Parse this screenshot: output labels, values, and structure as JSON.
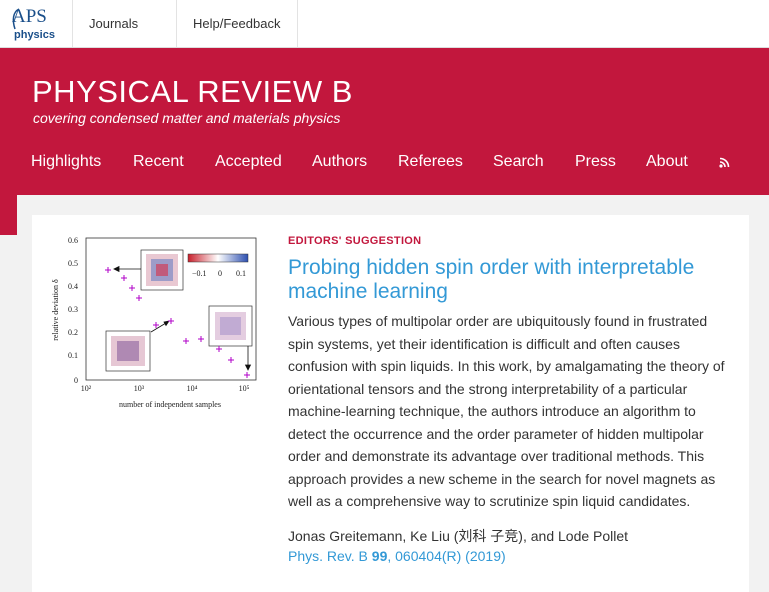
{
  "topbar": {
    "logo_aps": "APS",
    "logo_physics": "physics",
    "journals_label": "Journals",
    "help_label": "Help/Feedback"
  },
  "banner": {
    "journal_title": "PHYSICAL REVIEW B",
    "journal_subtitle": "covering condensed matter and materials physics",
    "menu": [
      "Highlights",
      "Recent",
      "Accepted",
      "Authors",
      "Referees",
      "Search",
      "Press",
      "About"
    ],
    "rss_icon": "rss-icon"
  },
  "article": {
    "label": "EDITORS' SUGGESTION",
    "title": "Probing hidden spin order with interpretable machine learning",
    "abstract": "Various types of multipolar order are ubiquitously found in frustrated spin systems, yet their identification is difficult and often causes confusion with spin liquids. In this work, by amalgamating the theory of orientational tensors and the strong interpretability of a particular machine-learning technique, the authors introduce an algorithm to detect the occurrence and the order parameter of hidden multipolar order and demonstrate its advantage over traditional methods. This approach provides a new scheme in the search for novel magnets as well as a comprehensive way to scrutinize spin liquid candidates.",
    "authors": "Jonas Greitemann, Ke Liu (刘科 子竞), and Lode Pollet",
    "citation_prefix": "Phys. Rev. B ",
    "citation_volume": "99",
    "citation_suffix": ", 060404(R) (2019)"
  },
  "figure": {
    "ylabel": "relative deviation δ",
    "xlabel": "number of independent samples",
    "y_ticks": [
      "0.6",
      "0.5",
      "0.4",
      "0.3",
      "0.2",
      "0.1",
      "0"
    ],
    "x_ticks": [
      "10²",
      "10³",
      "10⁴",
      "10⁵"
    ],
    "colorbar_ticks": [
      "−0.1",
      "0",
      "0.1"
    ],
    "colors": {
      "marker": "#b000c8",
      "accent": "#c2173d",
      "link": "#3399d6"
    }
  }
}
